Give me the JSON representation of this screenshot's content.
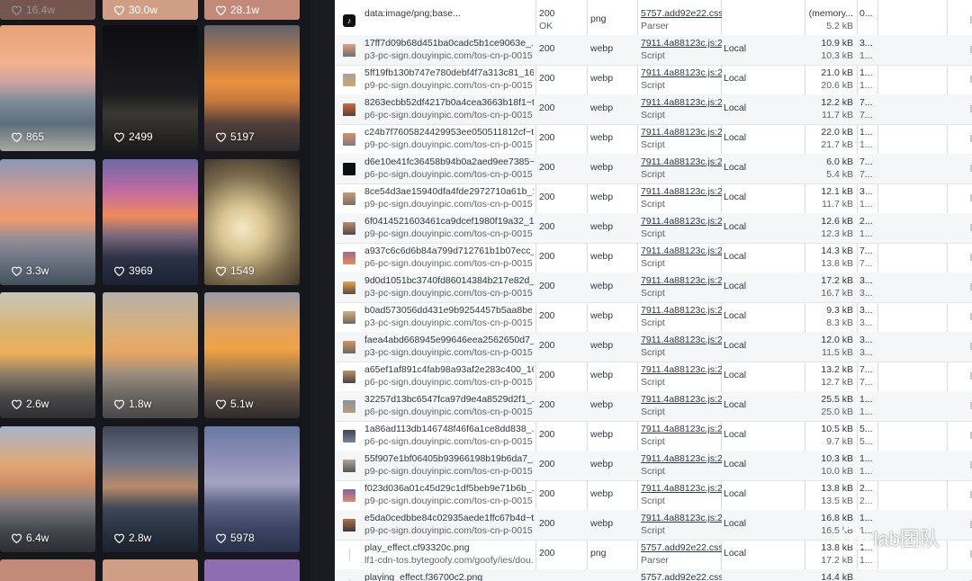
{
  "gallery": {
    "top_row": [
      {
        "likes": "16.4w"
      },
      {
        "likes": "30.0w"
      },
      {
        "likes": "28.1w"
      }
    ],
    "tiles": [
      {
        "likes": "865",
        "theme": "sunset-shore"
      },
      {
        "likes": "2499",
        "theme": "night-water"
      },
      {
        "likes": "5197",
        "theme": "orange-sunset"
      },
      {
        "likes": "3.3w",
        "theme": "pink-sky"
      },
      {
        "likes": "3969",
        "theme": "magenta-dusk"
      },
      {
        "likes": "1549",
        "theme": "wedding-couple"
      },
      {
        "likes": "2.6w",
        "theme": "golden-sky"
      },
      {
        "likes": "1.8w",
        "theme": "soft-sunset"
      },
      {
        "likes": "5.1w",
        "theme": "glowing-sunset"
      },
      {
        "likes": "6.4w",
        "theme": "cloudy-shore"
      },
      {
        "likes": "2.8w",
        "theme": "storm-sea"
      },
      {
        "likes": "5978",
        "theme": "blue-dusk"
      }
    ]
  },
  "network": {
    "rows": [
      {
        "name": "data:image/png;base...",
        "domain": "",
        "status": "200",
        "status2": "OK",
        "type": "png",
        "initiator": "5757.add92e22.css",
        "initiator_type": "Parser",
        "local": "",
        "size1": "(memory...",
        "size2": "5.2 kB",
        "time1": "0...",
        "time2": "",
        "thumb": "tiktok-icon"
      },
      {
        "name": "17ff7d09b68d451ba0cadc5b1ce9063e_...",
        "domain": "p3-pc-sign.douyinpic.com/tos-cn-p-0015",
        "status": "200",
        "status2": "",
        "type": "webp",
        "initiator": "7911.4a88123c.js:2",
        "initiator_type": "Script",
        "local": "Local",
        "size1": "10.9 kB",
        "size2": "10.3 kB",
        "time1": "3...",
        "time2": "1...",
        "thumb": "sunset-thumb"
      },
      {
        "name": "5ff19fb130b747e780debf4f7a313c81_16...",
        "domain": "p9-pc-sign.douyinpic.com/tos-cn-p-0015",
        "status": "200",
        "status2": "",
        "type": "webp",
        "initiator": "7911.4a88123c.js:2",
        "initiator_type": "Script",
        "local": "Local",
        "size1": "21.0 kB",
        "size2": "20.6 kB",
        "time1": "1...",
        "time2": "1...",
        "thumb": "sunset-thumb"
      },
      {
        "name": "8263ecbb52df4217b0a4cea3663b18f1~t...",
        "domain": "p6-pc-sign.douyinpic.com/tos-cn-p-0015",
        "status": "200",
        "status2": "",
        "type": "webp",
        "initiator": "7911.4a88123c.js:2",
        "initiator_type": "Script",
        "local": "Local",
        "size1": "12.2 kB",
        "size2": "11.7 kB",
        "time1": "7...",
        "time2": "7...",
        "thumb": "sunset-thumb"
      },
      {
        "name": "c24b7f7605824429953ee050511812cf~t...",
        "domain": "p9-pc-sign.douyinpic.com/tos-cn-p-0015",
        "status": "200",
        "status2": "",
        "type": "webp",
        "initiator": "7911.4a88123c.js:2",
        "initiator_type": "Script",
        "local": "Local",
        "size1": "22.0 kB",
        "size2": "21.7 kB",
        "time1": "1...",
        "time2": "1...",
        "thumb": "sunset-thumb"
      },
      {
        "name": "d6e10e41fc36458b94b0a2aed9ee7385~...",
        "domain": "p6-pc-sign.douyinpic.com/tos-cn-p-0015",
        "status": "200",
        "status2": "",
        "type": "webp",
        "initiator": "7911.4a88123c.js:2",
        "initiator_type": "Script",
        "local": "Local",
        "size1": "6.0 kB",
        "size2": "5.4 kB",
        "time1": "7...",
        "time2": "7...",
        "thumb": "dark-thumb"
      },
      {
        "name": "8ce54d3ae15940dfa4fde2972710a61b_1...",
        "domain": "p9-pc-sign.douyinpic.com/tos-cn-p-0015",
        "status": "200",
        "status2": "",
        "type": "webp",
        "initiator": "7911.4a88123c.js:2",
        "initiator_type": "Script",
        "local": "Local",
        "size1": "12.1 kB",
        "size2": "11.7 kB",
        "time1": "3...",
        "time2": "1...",
        "thumb": "sunset-thumb"
      },
      {
        "name": "6f0414521603461ca9dcef1980f19a32_1...",
        "domain": "p9-pc-sign.douyinpic.com/tos-cn-p-0015",
        "status": "200",
        "status2": "",
        "type": "webp",
        "initiator": "7911.4a88123c.js:2",
        "initiator_type": "Script",
        "local": "Local",
        "size1": "12.6 kB",
        "size2": "12.3 kB",
        "time1": "2...",
        "time2": "1...",
        "thumb": "sunset-thumb"
      },
      {
        "name": "a937c6c6d6b84a799d712761b1b07ecc_...",
        "domain": "p6-pc-sign.douyinpic.com/tos-cn-p-0015",
        "status": "200",
        "status2": "",
        "type": "webp",
        "initiator": "7911.4a88123c.js:2",
        "initiator_type": "Script",
        "local": "Local",
        "size1": "14.3 kB",
        "size2": "13.8 kB",
        "time1": "7...",
        "time2": "7...",
        "thumb": "sunset-thumb"
      },
      {
        "name": "9d0d1051bc3740fd86014384b217e82d_...",
        "domain": "p3-pc-sign.douyinpic.com/tos-cn-p-0015",
        "status": "200",
        "status2": "",
        "type": "webp",
        "initiator": "7911.4a88123c.js:2",
        "initiator_type": "Script",
        "local": "Local",
        "size1": "17.2 kB",
        "size2": "16.7 kB",
        "time1": "3...",
        "time2": "3...",
        "thumb": "sunset-thumb"
      },
      {
        "name": "b0ad573056dd431e9b9254457b5aa8be...",
        "domain": "p3-pc-sign.douyinpic.com/tos-cn-p-0015",
        "status": "200",
        "status2": "",
        "type": "webp",
        "initiator": "7911.4a88123c.js:2",
        "initiator_type": "Script",
        "local": "Local",
        "size1": "9.3 kB",
        "size2": "8.3 kB",
        "time1": "3...",
        "time2": "3...",
        "thumb": "sunset-thumb"
      },
      {
        "name": "faea4abd668945e99646eea2562650d7_...",
        "domain": "p3-pc-sign.douyinpic.com/tos-cn-p-0015",
        "status": "200",
        "status2": "",
        "type": "webp",
        "initiator": "7911.4a88123c.js:2",
        "initiator_type": "Script",
        "local": "Local",
        "size1": "12.0 kB",
        "size2": "11.5 kB",
        "time1": "3...",
        "time2": "3...",
        "thumb": "sunset-thumb"
      },
      {
        "name": "a65ef1af891c4fab98a93af2e283c400_16...",
        "domain": "p6-pc-sign.douyinpic.com/tos-cn-p-0015",
        "status": "200",
        "status2": "",
        "type": "webp",
        "initiator": "7911.4a88123c.js:2",
        "initiator_type": "Script",
        "local": "Local",
        "size1": "13.2 kB",
        "size2": "12.7 kB",
        "time1": "7...",
        "time2": "7...",
        "thumb": "sunset-thumb"
      },
      {
        "name": "32257d13bc6547fca97d9e4a8529d2f1_...",
        "domain": "p6-pc-sign.douyinpic.com/tos-cn-p-0015",
        "status": "200",
        "status2": "",
        "type": "webp",
        "initiator": "7911.4a88123c.js:2",
        "initiator_type": "Script",
        "local": "Local",
        "size1": "25.5 kB",
        "size2": "25.0 kB",
        "time1": "1...",
        "time2": "1...",
        "thumb": "sunset-thumb"
      },
      {
        "name": "1a86ad113db146748f46f6a1ce8dd838_...",
        "domain": "p6-pc-sign.douyinpic.com/tos-cn-p-0015",
        "status": "200",
        "status2": "",
        "type": "webp",
        "initiator": "7911.4a88123c.js:2",
        "initiator_type": "Script",
        "local": "Local",
        "size1": "10.5 kB",
        "size2": "9.7 kB",
        "time1": "5...",
        "time2": "5...",
        "thumb": "storm-thumb"
      },
      {
        "name": "55f907e1bf06405b93966198b19b6da7_...",
        "domain": "p9-pc-sign.douyinpic.com/tos-cn-p-0015",
        "status": "200",
        "status2": "",
        "type": "webp",
        "initiator": "7911.4a88123c.js:2",
        "initiator_type": "Script",
        "local": "Local",
        "size1": "10.3 kB",
        "size2": "10.0 kB",
        "time1": "1...",
        "time2": "1...",
        "thumb": "sunset-thumb"
      },
      {
        "name": "f023d036a01c45d29c1df5beb9e71b6b_...",
        "domain": "p9-pc-sign.douyinpic.com/tos-cn-p-0015",
        "status": "200",
        "status2": "",
        "type": "webp",
        "initiator": "7911.4a88123c.js:2",
        "initiator_type": "Script",
        "local": "Local",
        "size1": "13.8 kB",
        "size2": "13.5 kB",
        "time1": "2...",
        "time2": "2...",
        "thumb": "sunset-thumb"
      },
      {
        "name": "e5da0cedbbe84c02935aede1ffc67b4d~t...",
        "domain": "p9-pc-sign.douyinpic.com/tos-cn-p-0015",
        "status": "200",
        "status2": "",
        "type": "webp",
        "initiator": "7911.4a88123c.js:2",
        "initiator_type": "Script",
        "local": "Local",
        "size1": "16.8 kB",
        "size2": "16.5 kB",
        "time1": "1...",
        "time2": "1...",
        "thumb": "sunset-thumb"
      },
      {
        "name": "play_effect.cf93320c.png",
        "domain": "lf1-cdn-tos.bytegoofy.com/goofy/ies/dou...",
        "status": "200",
        "status2": "",
        "type": "png",
        "initiator": "5757.add92e22.css",
        "initiator_type": "Parser",
        "local": "Local",
        "size1": "13.8 kB",
        "size2": "17.2 kB",
        "time1": "1...",
        "time2": "1...",
        "thumb": "blank"
      },
      {
        "name": "playing_effect.f36700c2.png",
        "domain": "",
        "status": "",
        "status2": "",
        "type": "",
        "initiator": "5757.add92e22.css",
        "initiator_type": "",
        "local": "",
        "size1": "14.4 kB",
        "size2": "",
        "time1": "",
        "time2": "",
        "thumb": "blank"
      }
    ]
  },
  "watermark": {
    "text": "lab团队"
  },
  "colors": {
    "gallery_bg": "#16171c",
    "table_alt": "#f5f6f7",
    "text": "#303942",
    "muted": "#5f6368"
  }
}
